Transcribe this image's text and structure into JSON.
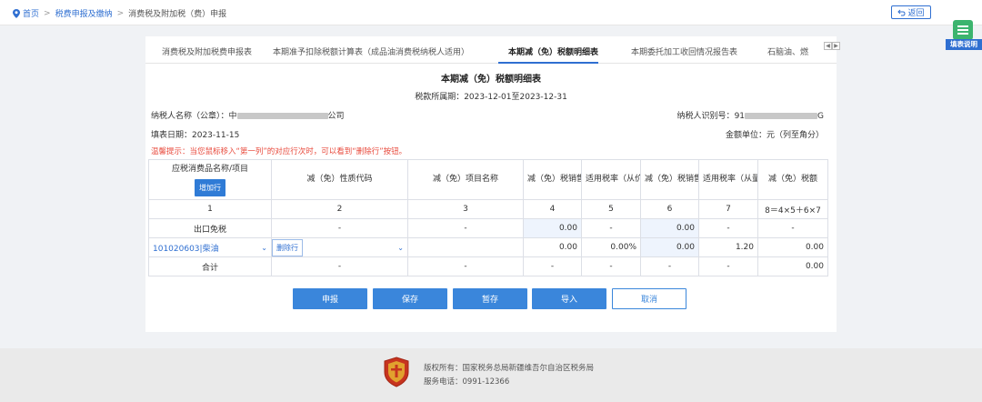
{
  "breadcrumb": {
    "home": "首页",
    "sep": ">",
    "level1": "税费申报及缴纳",
    "current": "消费税及附加税（费）申报"
  },
  "back_label": "返回",
  "help_label": "填表说明",
  "tabs": [
    {
      "label": "消费税及附加税费申报表"
    },
    {
      "label": "本期准予扣除税额计算表（成品油消费税纳税人适用）"
    },
    {
      "label": "本期减（免）税额明细表"
    },
    {
      "label": "本期委托加工收回情况报告表"
    },
    {
      "label": "石脑油、燃"
    }
  ],
  "form": {
    "title": "本期减（免）税额明细表",
    "period": "税款所属期：2023-12-01至2023-12-31",
    "taxpayer_name_label": "纳税人名称（公章）：",
    "taxpayer_name_prefix": "中",
    "taxpayer_name_suffix": "公司",
    "taxpayer_id_label": "纳税人识别号：",
    "taxpayer_id_prefix": "91",
    "taxpayer_id_suffix": "G",
    "fill_date": "填表日期：2023-11-15",
    "unit": "金额单位：元（列至角分）",
    "tip": "温馨提示：当您鼠标移入“第一列”的对应行次时，可以看到“删除行”按钮。"
  },
  "table": {
    "headers": [
      "应税消费品名称/项目",
      "减（免）性质代码",
      "减（免）项目名称",
      "减（免）税销售额",
      "适用税率（从价定率）",
      "减（免）税销售数量",
      "适用税率（从量定额）",
      "减（免）税额"
    ],
    "add_row_label": "增加行",
    "col_numbers": [
      "1",
      "2",
      "3",
      "4",
      "5",
      "6",
      "7",
      "8＝4×5＋6×7"
    ],
    "export_row": [
      "出口免税",
      "-",
      "-",
      "0.00",
      "-",
      "0.00",
      "-",
      "-"
    ],
    "item_row": {
      "product": "101020603|柴油",
      "delete_label": "删除行",
      "code": "",
      "name": "",
      "sales": "0.00",
      "rate_value": "0.00%",
      "qty": "0.00",
      "rate_qty": "1.20",
      "tax": "0.00"
    },
    "total_row": [
      "合计",
      "-",
      "-",
      "-",
      "-",
      "-",
      "-",
      "0.00"
    ]
  },
  "actions": {
    "declare": "申报",
    "save": "保存",
    "temp_save": "暂存",
    "import": "导入",
    "cancel": "取消"
  },
  "footer": {
    "copyright": "版权所有：国家税务总局新疆维吾尔自治区税务局",
    "phone": "服务电话：0991-12366"
  },
  "colors": {
    "accent": "#2f6fd1",
    "tip_red": "#e84a3c",
    "help_green": "#3cb46e"
  }
}
